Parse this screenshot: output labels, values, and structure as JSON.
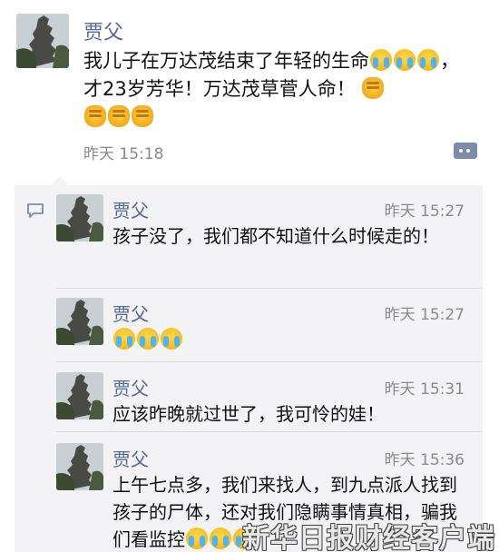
{
  "post": {
    "author": "贾父",
    "text_1": "我儿子在万达茂结束了年轻的生命",
    "text_2": "，才23岁芳华！万达茂草菅人命！",
    "time": "昨天 15:18"
  },
  "comments": [
    {
      "author": "贾父",
      "time": "昨天 15:27",
      "text": "孩子没了，我们都不知道什么时候走的！"
    },
    {
      "author": "贾父",
      "time": "昨天 15:27",
      "text": ""
    },
    {
      "author": "贾父",
      "time": "昨天 15:31",
      "text": "应该昨晚就过世了，我可怜的娃！"
    },
    {
      "author": "贾父",
      "time": "昨天 15:36",
      "text": "上午七点多，我们来找人，到九点派人找到孩子的尸体，还对我们隐瞒事情真相，骗我们看监控"
    }
  ],
  "watermark": "新华日报财经客户端",
  "icons": {
    "cry": "crying-face-emoji",
    "fist": "fist-emoji",
    "more": "more-actions-icon",
    "comment": "comment-icon"
  }
}
